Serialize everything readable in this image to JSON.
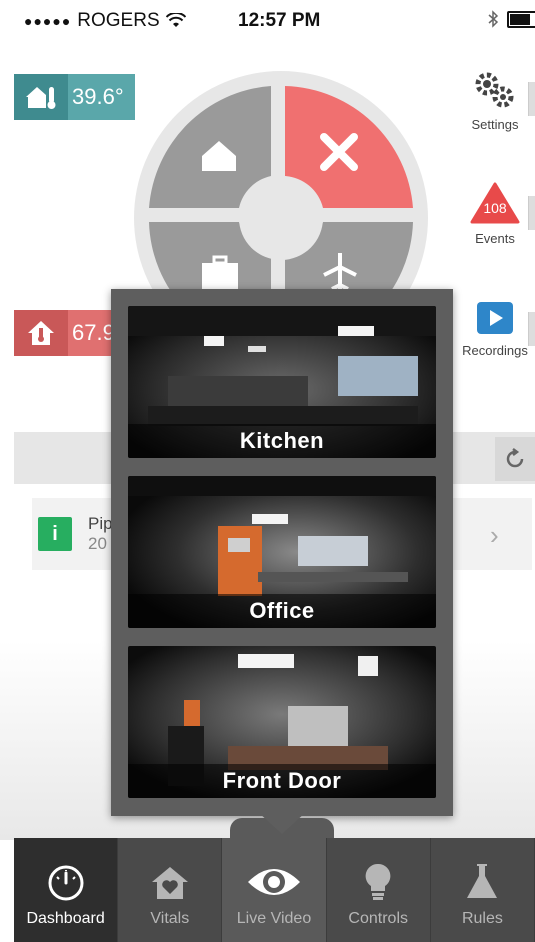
{
  "status_bar": {
    "carrier": "ROGERS",
    "signal_dots": "●●●●●",
    "time": "12:57 PM"
  },
  "vitals": {
    "indoor_temp": "39.6°",
    "outdoor_temp": "67.9"
  },
  "side_actions": [
    {
      "label": "Settings"
    },
    {
      "label": "Events",
      "count": "108"
    },
    {
      "label": "Recordings"
    }
  ],
  "notification": {
    "title": "Pip",
    "subtitle": "20"
  },
  "cameras": [
    {
      "name": "Kitchen"
    },
    {
      "name": "Office"
    },
    {
      "name": "Front Door"
    }
  ],
  "tabs": [
    {
      "label": "Dashboard",
      "icon": "gauge-icon"
    },
    {
      "label": "Vitals",
      "icon": "home-heart-icon"
    },
    {
      "label": "Live Video",
      "icon": "eye-icon"
    },
    {
      "label": "Controls",
      "icon": "lightbulb-icon"
    },
    {
      "label": "Rules",
      "icon": "flask-icon"
    }
  ],
  "colors": {
    "teal": "#5aa7aa",
    "red": "#e07070",
    "active_segment": "#f07070",
    "events_badge": "#e84a4a",
    "recordings": "#2e86c9",
    "notice_green": "#27ae60"
  }
}
